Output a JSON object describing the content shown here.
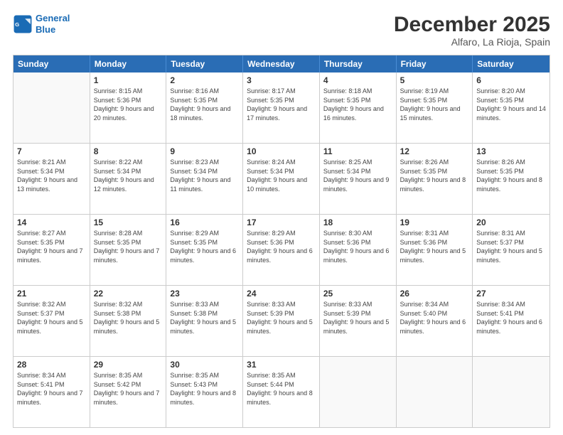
{
  "header": {
    "logo_line1": "General",
    "logo_line2": "Blue",
    "month": "December 2025",
    "location": "Alfaro, La Rioja, Spain"
  },
  "days_of_week": [
    "Sunday",
    "Monday",
    "Tuesday",
    "Wednesday",
    "Thursday",
    "Friday",
    "Saturday"
  ],
  "weeks": [
    [
      {
        "day": "",
        "empty": true
      },
      {
        "day": "1",
        "sunrise": "Sunrise: 8:15 AM",
        "sunset": "Sunset: 5:36 PM",
        "daylight": "Daylight: 9 hours and 20 minutes."
      },
      {
        "day": "2",
        "sunrise": "Sunrise: 8:16 AM",
        "sunset": "Sunset: 5:35 PM",
        "daylight": "Daylight: 9 hours and 18 minutes."
      },
      {
        "day": "3",
        "sunrise": "Sunrise: 8:17 AM",
        "sunset": "Sunset: 5:35 PM",
        "daylight": "Daylight: 9 hours and 17 minutes."
      },
      {
        "day": "4",
        "sunrise": "Sunrise: 8:18 AM",
        "sunset": "Sunset: 5:35 PM",
        "daylight": "Daylight: 9 hours and 16 minutes."
      },
      {
        "day": "5",
        "sunrise": "Sunrise: 8:19 AM",
        "sunset": "Sunset: 5:35 PM",
        "daylight": "Daylight: 9 hours and 15 minutes."
      },
      {
        "day": "6",
        "sunrise": "Sunrise: 8:20 AM",
        "sunset": "Sunset: 5:35 PM",
        "daylight": "Daylight: 9 hours and 14 minutes."
      }
    ],
    [
      {
        "day": "7",
        "sunrise": "Sunrise: 8:21 AM",
        "sunset": "Sunset: 5:34 PM",
        "daylight": "Daylight: 9 hours and 13 minutes."
      },
      {
        "day": "8",
        "sunrise": "Sunrise: 8:22 AM",
        "sunset": "Sunset: 5:34 PM",
        "daylight": "Daylight: 9 hours and 12 minutes."
      },
      {
        "day": "9",
        "sunrise": "Sunrise: 8:23 AM",
        "sunset": "Sunset: 5:34 PM",
        "daylight": "Daylight: 9 hours and 11 minutes."
      },
      {
        "day": "10",
        "sunrise": "Sunrise: 8:24 AM",
        "sunset": "Sunset: 5:34 PM",
        "daylight": "Daylight: 9 hours and 10 minutes."
      },
      {
        "day": "11",
        "sunrise": "Sunrise: 8:25 AM",
        "sunset": "Sunset: 5:34 PM",
        "daylight": "Daylight: 9 hours and 9 minutes."
      },
      {
        "day": "12",
        "sunrise": "Sunrise: 8:26 AM",
        "sunset": "Sunset: 5:35 PM",
        "daylight": "Daylight: 9 hours and 8 minutes."
      },
      {
        "day": "13",
        "sunrise": "Sunrise: 8:26 AM",
        "sunset": "Sunset: 5:35 PM",
        "daylight": "Daylight: 9 hours and 8 minutes."
      }
    ],
    [
      {
        "day": "14",
        "sunrise": "Sunrise: 8:27 AM",
        "sunset": "Sunset: 5:35 PM",
        "daylight": "Daylight: 9 hours and 7 minutes."
      },
      {
        "day": "15",
        "sunrise": "Sunrise: 8:28 AM",
        "sunset": "Sunset: 5:35 PM",
        "daylight": "Daylight: 9 hours and 7 minutes."
      },
      {
        "day": "16",
        "sunrise": "Sunrise: 8:29 AM",
        "sunset": "Sunset: 5:35 PM",
        "daylight": "Daylight: 9 hours and 6 minutes."
      },
      {
        "day": "17",
        "sunrise": "Sunrise: 8:29 AM",
        "sunset": "Sunset: 5:36 PM",
        "daylight": "Daylight: 9 hours and 6 minutes."
      },
      {
        "day": "18",
        "sunrise": "Sunrise: 8:30 AM",
        "sunset": "Sunset: 5:36 PM",
        "daylight": "Daylight: 9 hours and 6 minutes."
      },
      {
        "day": "19",
        "sunrise": "Sunrise: 8:31 AM",
        "sunset": "Sunset: 5:36 PM",
        "daylight": "Daylight: 9 hours and 5 minutes."
      },
      {
        "day": "20",
        "sunrise": "Sunrise: 8:31 AM",
        "sunset": "Sunset: 5:37 PM",
        "daylight": "Daylight: 9 hours and 5 minutes."
      }
    ],
    [
      {
        "day": "21",
        "sunrise": "Sunrise: 8:32 AM",
        "sunset": "Sunset: 5:37 PM",
        "daylight": "Daylight: 9 hours and 5 minutes."
      },
      {
        "day": "22",
        "sunrise": "Sunrise: 8:32 AM",
        "sunset": "Sunset: 5:38 PM",
        "daylight": "Daylight: 9 hours and 5 minutes."
      },
      {
        "day": "23",
        "sunrise": "Sunrise: 8:33 AM",
        "sunset": "Sunset: 5:38 PM",
        "daylight": "Daylight: 9 hours and 5 minutes."
      },
      {
        "day": "24",
        "sunrise": "Sunrise: 8:33 AM",
        "sunset": "Sunset: 5:39 PM",
        "daylight": "Daylight: 9 hours and 5 minutes."
      },
      {
        "day": "25",
        "sunrise": "Sunrise: 8:33 AM",
        "sunset": "Sunset: 5:39 PM",
        "daylight": "Daylight: 9 hours and 5 minutes."
      },
      {
        "day": "26",
        "sunrise": "Sunrise: 8:34 AM",
        "sunset": "Sunset: 5:40 PM",
        "daylight": "Daylight: 9 hours and 6 minutes."
      },
      {
        "day": "27",
        "sunrise": "Sunrise: 8:34 AM",
        "sunset": "Sunset: 5:41 PM",
        "daylight": "Daylight: 9 hours and 6 minutes."
      }
    ],
    [
      {
        "day": "28",
        "sunrise": "Sunrise: 8:34 AM",
        "sunset": "Sunset: 5:41 PM",
        "daylight": "Daylight: 9 hours and 7 minutes."
      },
      {
        "day": "29",
        "sunrise": "Sunrise: 8:35 AM",
        "sunset": "Sunset: 5:42 PM",
        "daylight": "Daylight: 9 hours and 7 minutes."
      },
      {
        "day": "30",
        "sunrise": "Sunrise: 8:35 AM",
        "sunset": "Sunset: 5:43 PM",
        "daylight": "Daylight: 9 hours and 8 minutes."
      },
      {
        "day": "31",
        "sunrise": "Sunrise: 8:35 AM",
        "sunset": "Sunset: 5:44 PM",
        "daylight": "Daylight: 9 hours and 8 minutes."
      },
      {
        "day": "",
        "empty": true
      },
      {
        "day": "",
        "empty": true
      },
      {
        "day": "",
        "empty": true
      }
    ]
  ]
}
